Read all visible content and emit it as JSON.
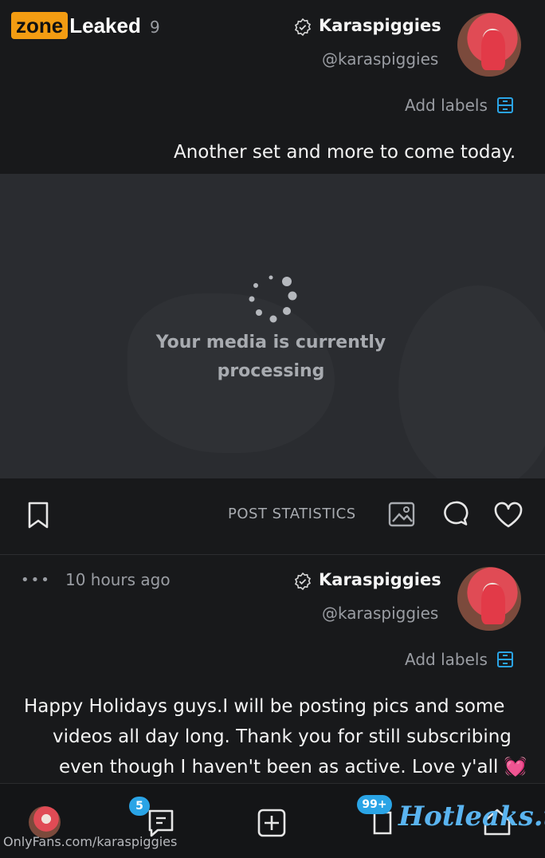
{
  "watermarks": {
    "leaked_part1": "zone",
    "leaked_part2": "Leaked",
    "hotleaks": "Hotleaks.tv",
    "url": "OnlyFans.com/karaspiggies"
  },
  "post1": {
    "name": "Karaspiggies",
    "handle": "@karaspiggies",
    "time_fragment": "9",
    "add_labels": "Add labels",
    "text": "Another set and more to come today."
  },
  "media": {
    "processing_line1": "Your media is currently",
    "processing_line2": "processing"
  },
  "actions": {
    "post_statistics": "POST STATISTICS"
  },
  "post2": {
    "name": "Karaspiggies",
    "handle": "@karaspiggies",
    "time": "10 hours ago",
    "more": "•••",
    "add_labels": "Add labels",
    "text_line1": "Happy Holidays guys.I will be posting pics and some",
    "text_line2": "videos all day long. Thank you for still subscribing",
    "text_line3": "even though I haven't been as active. Love y'all 💓"
  },
  "nav": {
    "messages_badge": "5",
    "notifications_badge": "99+"
  },
  "colors": {
    "accent": "#2aa4e6",
    "background": "#18191b",
    "media_bg": "#2a2c30"
  }
}
